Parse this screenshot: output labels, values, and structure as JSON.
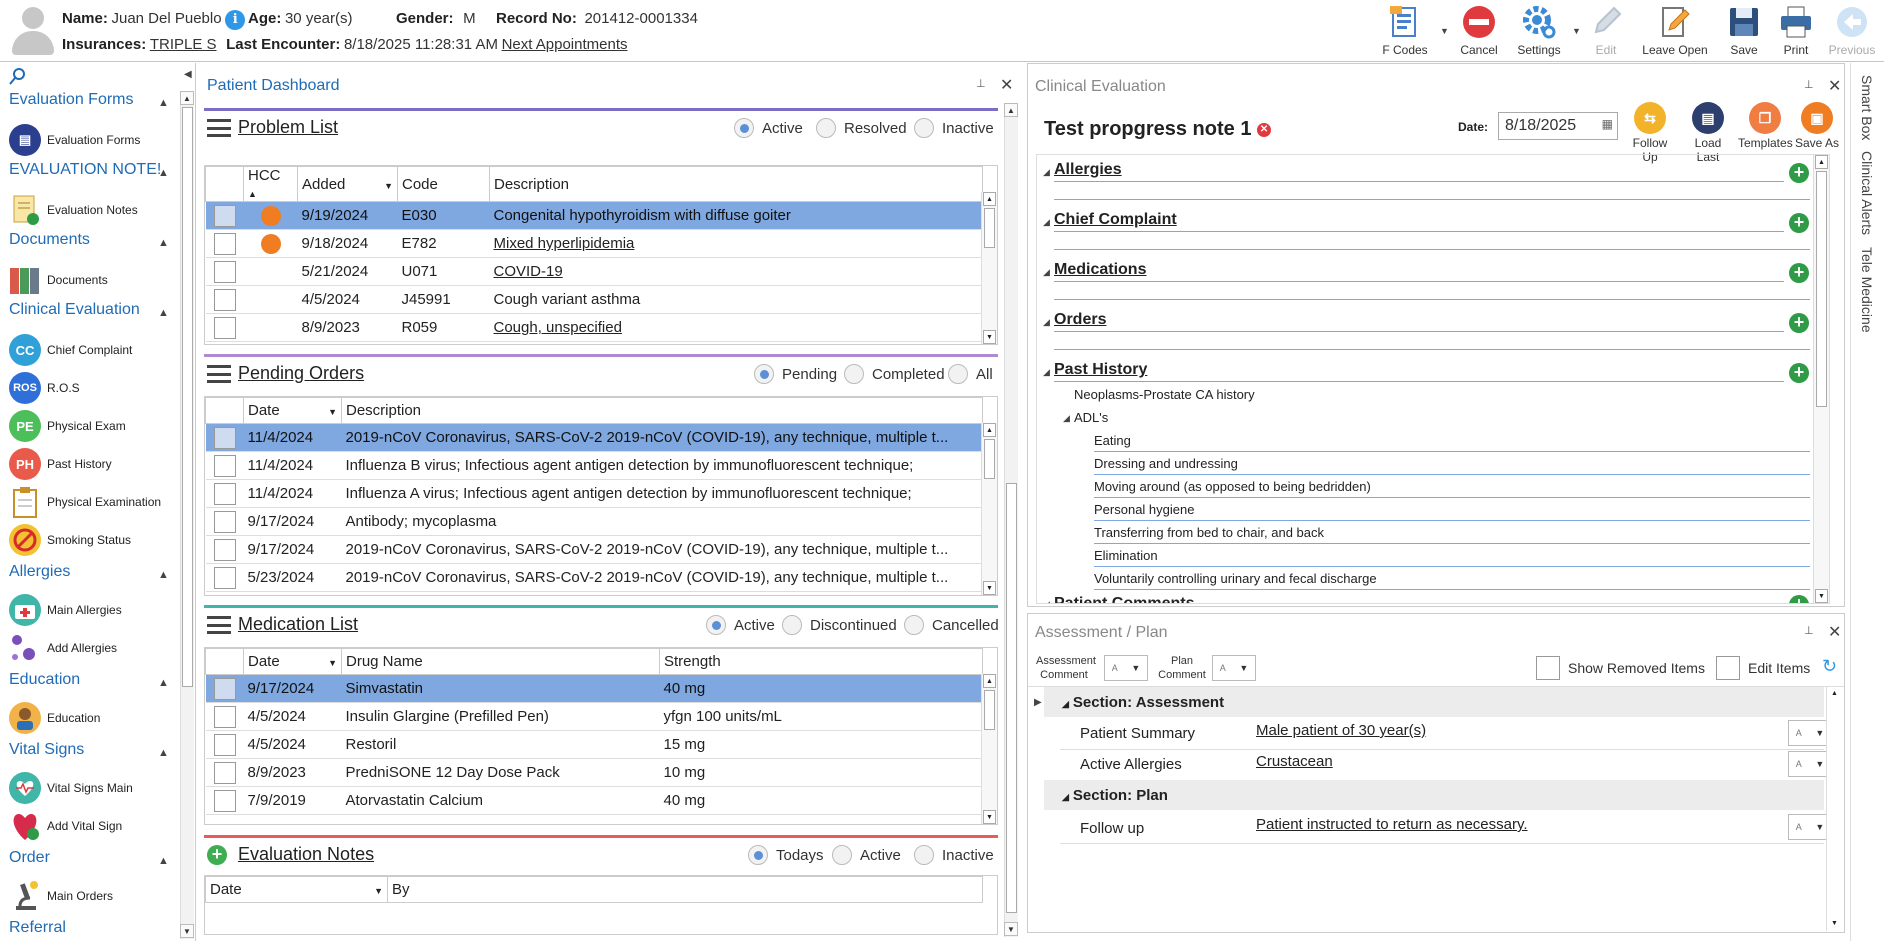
{
  "header": {
    "name_label": "Name:",
    "name": "Juan Del Pueblo",
    "age_label": "Age:",
    "age": "30 year(s)",
    "gender_label": "Gender:",
    "gender": "M",
    "record_label": "Record No:",
    "record": "201412-0001334",
    "insurance_label": "Insurances:",
    "insurance": "TRIPLE S",
    "encounter_label": "Last Encounter:",
    "encounter": "8/18/2025 11:28:31 AM",
    "next_appointments": "Next Appointments"
  },
  "toolbar": {
    "fcodes": "F Codes",
    "cancel": "Cancel",
    "settings": "Settings",
    "edit": "Edit",
    "leave_open": "Leave Open",
    "save": "Save",
    "print": "Print",
    "previous": "Previous"
  },
  "nav": {
    "groups": {
      "eval_forms": "Evaluation Forms",
      "eval_notes": "EVALUATION NOTE!",
      "documents": "Documents",
      "clinical_eval": "Clinical Evaluation",
      "allergies": "Allergies",
      "education": "Education",
      "vital_signs": "Vital Signs",
      "order": "Order",
      "referral": "Referral"
    },
    "items": {
      "eval_forms": "Evaluation Forms",
      "eval_notes": "Evaluation Notes",
      "documents": "Documents",
      "chief_complaint": "Chief Complaint",
      "ros": "R.O.S",
      "physical_exam": "Physical Exam",
      "past_history": "Past History",
      "physical_examination": "Physical Examination",
      "smoking_status": "Smoking Status",
      "main_allergies": "Main Allergies",
      "add_allergies": "Add Allergies",
      "education": "Education",
      "vital_signs_main": "Vital Signs Main",
      "add_vital_sign": "Add Vital Sign",
      "main_orders": "Main Orders"
    },
    "icon_text": {
      "cc": "CC",
      "ros": "ROS",
      "pe": "PE",
      "ph": "PH"
    }
  },
  "dashboard": {
    "title": "Patient Dashboard",
    "problem_list": {
      "title": "Problem List",
      "filters": [
        "Active",
        "Resolved",
        "Inactive"
      ],
      "columns": [
        "HCC",
        "Added",
        "Code",
        "Description"
      ],
      "rows": [
        {
          "added": "9/19/2024",
          "code": "E030",
          "desc": "Congenital hypothyroidism with diffuse goiter"
        },
        {
          "added": "9/18/2024",
          "code": "E782",
          "desc": "Mixed hyperlipidemia"
        },
        {
          "added": "5/21/2024",
          "code": "U071",
          "desc": "COVID-19"
        },
        {
          "added": "4/5/2024",
          "code": "J45991",
          "desc": "Cough variant asthma"
        },
        {
          "added": "8/9/2023",
          "code": "R059",
          "desc": "Cough, unspecified"
        }
      ]
    },
    "pending_orders": {
      "title": "Pending Orders",
      "filters": [
        "Pending",
        "Completed",
        "All"
      ],
      "columns": [
        "Date",
        "Description"
      ],
      "rows": [
        {
          "date": "11/4/2024",
          "desc": "2019-nCoV Coronavirus, SARS-CoV-2 2019-nCoV (COVID-19), any technique, multiple t..."
        },
        {
          "date": "11/4/2024",
          "desc": "Influenza B virus; Infectious agent antigen detection by immunofluorescent technique;"
        },
        {
          "date": "11/4/2024",
          "desc": "Influenza A virus; Infectious agent antigen detection by immunofluorescent technique;"
        },
        {
          "date": "9/17/2024",
          "desc": "Antibody; mycoplasma"
        },
        {
          "date": "9/17/2024",
          "desc": "2019-nCoV Coronavirus, SARS-CoV-2 2019-nCoV (COVID-19), any technique, multiple t..."
        },
        {
          "date": "5/23/2024",
          "desc": "2019-nCoV Coronavirus, SARS-CoV-2 2019-nCoV (COVID-19), any technique, multiple t..."
        }
      ]
    },
    "medication_list": {
      "title": "Medication List",
      "filters": [
        "Active",
        "Discontinued",
        "Cancelled"
      ],
      "columns": [
        "Date",
        "Drug Name",
        "Strength"
      ],
      "rows": [
        {
          "date": "9/17/2024",
          "drug": "Simvastatin",
          "strength": "40 mg"
        },
        {
          "date": "4/5/2024",
          "drug": "Insulin Glargine (Prefilled Pen)",
          "strength": "yfgn 100 units/mL"
        },
        {
          "date": "4/5/2024",
          "drug": "Restoril",
          "strength": "15 mg"
        },
        {
          "date": "8/9/2023",
          "drug": "PredniSONE 12 Day Dose Pack",
          "strength": "10 mg"
        },
        {
          "date": "7/9/2019",
          "drug": "Atorvastatin Calcium",
          "strength": "40 mg"
        }
      ]
    },
    "evaluation_notes": {
      "title": "Evaluation Notes",
      "filters": [
        "Todays",
        "Active",
        "Inactive"
      ],
      "columns": [
        "Date",
        "By"
      ]
    }
  },
  "clinical": {
    "title": "Clinical Evaluation",
    "note_title": "Test propgress note 1",
    "date_label": "Date:",
    "date": "8/18/2025",
    "buttons": [
      "Follow Up",
      "Load Last",
      "Templates",
      "Save As"
    ],
    "sections": [
      "Allergies",
      "Chief Complaint",
      "Medications",
      "Orders",
      "Past History",
      "Patient Comments"
    ],
    "past_history": {
      "item1": "Neoplasms-Prostate CA history",
      "adls": "ADL's",
      "adl_items": [
        "Eating",
        "Dressing and undressing",
        "Moving around (as opposed to being bedridden)",
        "Personal hygiene",
        "Transferring from bed to chair, and back",
        "Elimination",
        "Voluntarily controlling urinary and fecal discharge"
      ]
    }
  },
  "assessment": {
    "title": "Assessment / Plan",
    "assessment_comment": "Assessment Comment",
    "plan_comment": "Plan Comment",
    "show_removed": "Show Removed Items",
    "edit_items": "Edit Items",
    "section_assessment": "Section: Assessment",
    "section_plan": "Section: Plan",
    "rows": [
      {
        "label": "Patient Summary",
        "value": "Male patient of 30 year(s)"
      },
      {
        "label": "Active Allergies",
        "value": "Crustacean"
      },
      {
        "label": "Follow up",
        "value": "Patient instructed to return as necessary."
      }
    ]
  },
  "side_tabs": [
    "Smart Box",
    "Clinical Alerts",
    "Tele Medicine"
  ],
  "colors": {
    "accent": "#1f6bb5",
    "selection": "#7fa7e0",
    "hcc_dot": "#f07d22",
    "add_green": "#2f9b47"
  }
}
